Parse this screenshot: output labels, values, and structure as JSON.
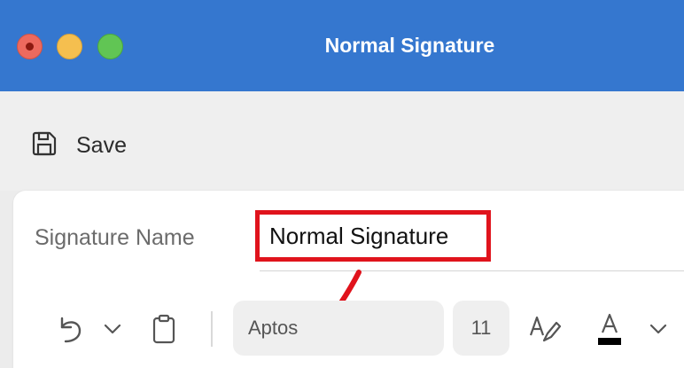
{
  "window": {
    "title": "Normal Signature"
  },
  "toolbar": {
    "save_label": "Save",
    "save_icon": "floppy-disk-icon"
  },
  "signature": {
    "label": "Signature Name",
    "value": "Normal Signature",
    "highlight_color": "#e0131c"
  },
  "format": {
    "font": "Aptos",
    "size": "11",
    "icons": [
      "undo-icon",
      "chevron-down-icon",
      "clipboard-icon",
      "highlight-pen-icon",
      "font-color-icon",
      "chevron-down-icon"
    ]
  },
  "colors": {
    "titlebar": "#3577cf",
    "annotation_arrow": "#e0131c"
  }
}
